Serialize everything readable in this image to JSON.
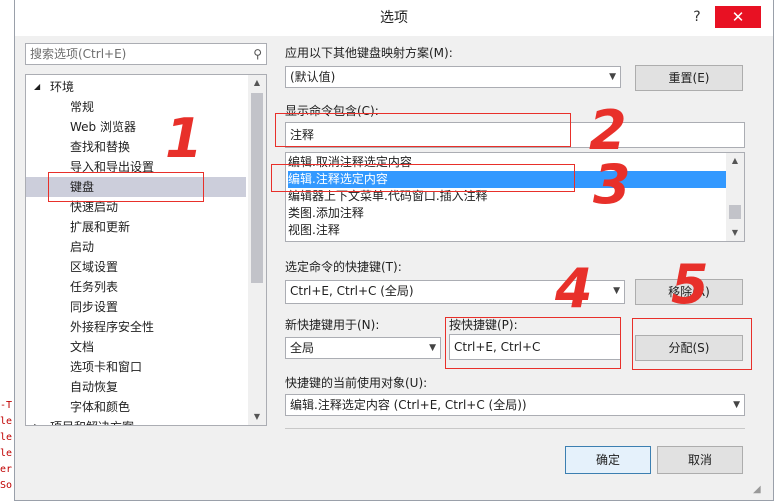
{
  "dialog": {
    "title": "选项",
    "help_glyph": "?",
    "close_glyph": "✕"
  },
  "search": {
    "placeholder": "搜索选项(Ctrl+E)"
  },
  "tree": {
    "root_label": "环境",
    "items": [
      "常规",
      "Web 浏览器",
      "查找和替换",
      "导入和导出设置",
      "键盘",
      "快速启动",
      "扩展和更新",
      "启动",
      "区域设置",
      "任务列表",
      "同步设置",
      "外接程序安全性",
      "文档",
      "选项卡和窗口",
      "自动恢复",
      "字体和颜色"
    ],
    "selected_index": 4,
    "next_root_label": "项目和解决方案"
  },
  "mapping": {
    "label": "应用以下其他键盘映射方案(M):",
    "value": "(默认值)",
    "reset_label": "重置(E)"
  },
  "commands": {
    "filter_label": "显示命令包含(C):",
    "filter_value": "注释",
    "items": [
      "编辑.取消注释选定内容",
      "编辑.注释选定内容",
      "编辑器上下文菜单.代码窗口.插入注释",
      "类图.添加注释",
      "视图.注释"
    ],
    "selected_index": 1
  },
  "shortcuts": {
    "label": "选定命令的快捷键(T):",
    "value": "Ctrl+E, Ctrl+C (全局)",
    "remove_label": "移除(R)"
  },
  "new_shortcut": {
    "scope_label": "新快捷键用于(N):",
    "scope_value": "全局",
    "keys_label": "按快捷键(P):",
    "keys_value": "Ctrl+E, Ctrl+C",
    "assign_label": "分配(S)"
  },
  "used_by": {
    "label": "快捷键的当前使用对象(U):",
    "value": "编辑.注释选定内容 (Ctrl+E, Ctrl+C (全局))"
  },
  "footer": {
    "ok_label": "确定",
    "cancel_label": "取消"
  },
  "annotations": [
    "1",
    "2",
    "3",
    "4",
    "5"
  ],
  "background_code": [
    "-T",
    "le",
    "le",
    "le",
    "er",
    "So"
  ],
  "colors": {
    "annotation_red": "#e8302a",
    "selection_blue": "#3399ff",
    "tree_selection": "#cccedb"
  }
}
